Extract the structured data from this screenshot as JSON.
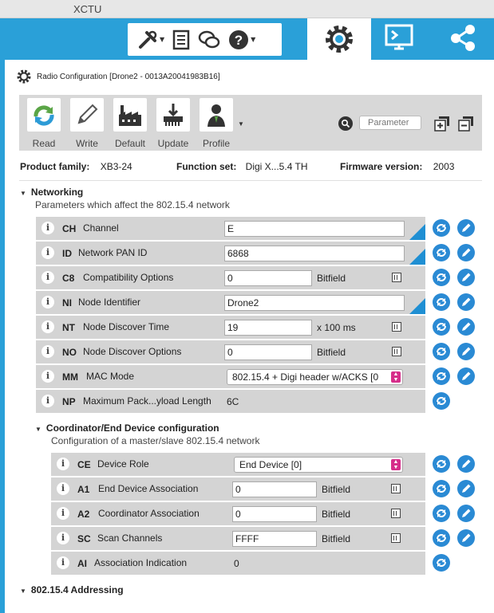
{
  "window": {
    "title": "XCTU"
  },
  "header": {
    "title": "Radio Configuration [Drone2 - 0013A20041983B16]"
  },
  "actions": [
    {
      "label": "Read",
      "icon": "read-icon"
    },
    {
      "label": "Write",
      "icon": "write-icon"
    },
    {
      "label": "Default",
      "icon": "default-icon"
    },
    {
      "label": "Update",
      "icon": "update-icon"
    },
    {
      "label": "Profile",
      "icon": "profile-icon"
    }
  ],
  "search": {
    "placeholder": "Parameter"
  },
  "product": {
    "family_label": "Product family:",
    "family": "XB3-24",
    "function_label": "Function set:",
    "function": "Digi X...5.4 TH",
    "firmware_label": "Firmware version:",
    "firmware": "2003"
  },
  "networking": {
    "title": "Networking",
    "desc": "Parameters which affect the 802.15.4 network",
    "rows": [
      {
        "code": "CH",
        "name": "Channel",
        "value": "E"
      },
      {
        "code": "ID",
        "name": "Network PAN ID",
        "value": "6868"
      },
      {
        "code": "C8",
        "name": "Compatibility Options",
        "value": "0",
        "unit": "Bitfield"
      },
      {
        "code": "NI",
        "name": "Node Identifier",
        "value": "Drone2"
      },
      {
        "code": "NT",
        "name": "Node Discover Time",
        "value": "19",
        "unit": "x 100 ms"
      },
      {
        "code": "NO",
        "name": "Node Discover Options",
        "value": "0",
        "unit": "Bitfield"
      },
      {
        "code": "MM",
        "name": "MAC Mode",
        "value": "802.15.4 + Digi header w/ACKS [0"
      },
      {
        "code": "NP",
        "name": "Maximum Pack...yload Length",
        "value": "6C"
      }
    ]
  },
  "coordinator": {
    "title": "Coordinator/End Device configuration",
    "desc": "Configuration of a master/slave 802.15.4 network",
    "rows": [
      {
        "code": "CE",
        "name": "Device Role",
        "value": "End Device [0]"
      },
      {
        "code": "A1",
        "name": "End Device Association",
        "value": "0",
        "unit": "Bitfield"
      },
      {
        "code": "A2",
        "name": "Coordinator Association",
        "value": "0",
        "unit": "Bitfield"
      },
      {
        "code": "SC",
        "name": "Scan Channels",
        "value": "FFFF",
        "unit": "Bitfield"
      },
      {
        "code": "AI",
        "name": "Association Indication",
        "value": "0"
      }
    ]
  },
  "addressing": {
    "title": "802.15.4 Addressing"
  },
  "colors": {
    "accent": "#2aa0d8",
    "button": "#2a8ad4",
    "row": "#d4d4d4",
    "select_arrow": "#d62d8a"
  }
}
